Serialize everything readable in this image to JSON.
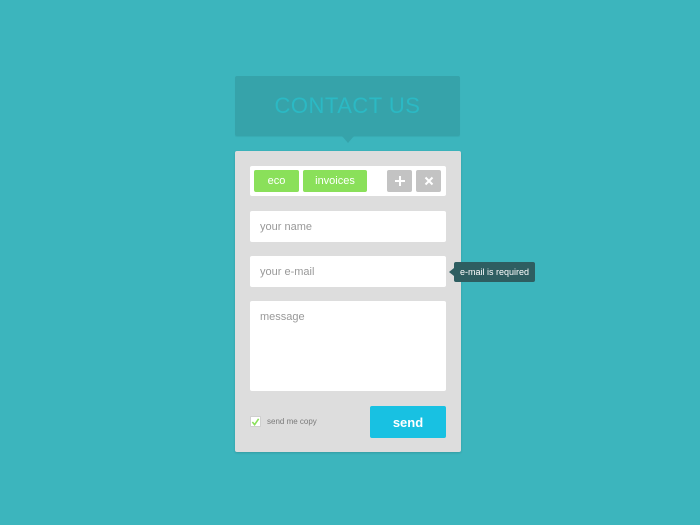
{
  "header": {
    "title": "CONTACT US"
  },
  "tags": [
    {
      "label": "eco"
    },
    {
      "label": "invoices"
    }
  ],
  "tag_actions": {
    "add_icon": "plus-icon",
    "remove_icon": "close-icon"
  },
  "form": {
    "name_placeholder": "your name",
    "email_placeholder": "your e-mail",
    "message_placeholder": "message"
  },
  "validation": {
    "email_error": "e-mail is required"
  },
  "copy": {
    "label": "send me copy",
    "checked": true
  },
  "send": {
    "label": "send"
  },
  "colors": {
    "background": "#3cb5bd",
    "header": "#36a3aa",
    "tag": "#8ae05a",
    "send": "#18c1e2",
    "tooltip": "#2e5e61"
  }
}
